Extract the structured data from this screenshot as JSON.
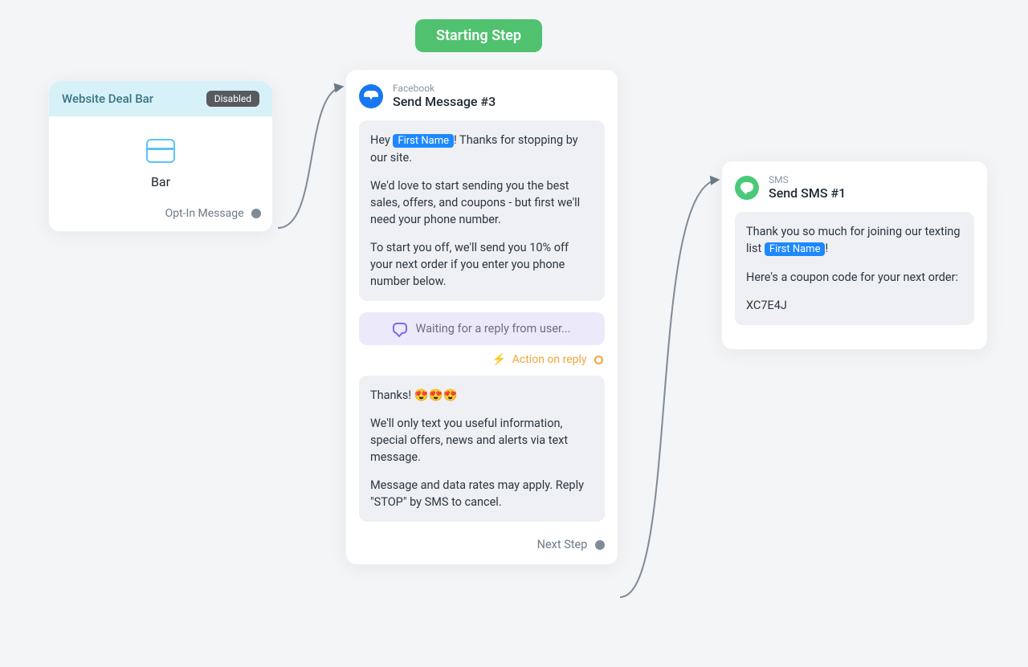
{
  "startingStep": "Starting Step",
  "barCard": {
    "title": "Website Deal Bar",
    "status": "Disabled",
    "label": "Bar",
    "footerLabel": "Opt-In Message"
  },
  "msgCard": {
    "channel": "Facebook",
    "title": "Send Message #3",
    "msg1": {
      "line1a": "Hey ",
      "token": "First Name",
      "line1b": "! Thanks for stopping by our site.",
      "para2": "We'd love to start sending you the best sales, offers, and coupons - but first we'll need your phone number.",
      "para3": "To start you off, we'll send you 10% off your next order if you enter you phone number below."
    },
    "waitingText": "Waiting for a reply from user...",
    "actionReply": "Action on reply",
    "msg2": {
      "para1": "Thanks! 😍😍😍",
      "para2": "We'll only text you useful information, special offers, news and alerts via text message.",
      "para3": "Message and data rates may apply. Reply \"STOP\" by SMS to cancel."
    },
    "footerLabel": "Next Step"
  },
  "smsCard": {
    "channel": "SMS",
    "title": "Send SMS #1",
    "msg": {
      "line1a": "Thank you so much for joining our texting list ",
      "token": "First Name",
      "line1b": "!",
      "para2": "Here's a coupon code for your next order:",
      "para3": "XC7E4J"
    }
  }
}
